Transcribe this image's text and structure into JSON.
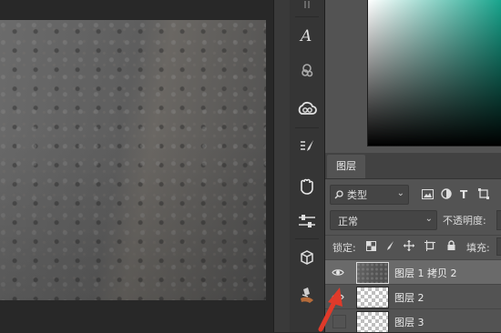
{
  "toolbar_icons": [
    "grip-icon",
    "character-icon",
    "paragraph-style-icon",
    "creative-cloud-icon",
    "brush-settings-icon",
    "glyph-hand-icon",
    "adjustments-icon",
    "3d-object-icon",
    "clone-source-icon"
  ],
  "colors": {
    "accent_teal": "#17a48c",
    "panel_bg": "#535353",
    "selected_row": "#6a6a6a",
    "arrow": "#e03a2a"
  },
  "layers_panel": {
    "tab_label": "图层",
    "filter": {
      "label": "类型",
      "icons": [
        "search-icon",
        "image-filter-icon",
        "adjustment-filter-icon",
        "text-filter-icon",
        "shape-filter-icon"
      ]
    },
    "blend_mode": "正常",
    "opacity_label": "不透明度:",
    "lock_label": "锁定:",
    "fill_label": "填充:",
    "layers": [
      {
        "name": "图层 1 拷贝 2",
        "visible": true,
        "selected": true
      },
      {
        "name": "图层 2",
        "visible": true,
        "selected": false
      },
      {
        "name": "图层 3",
        "visible": false,
        "selected": false
      }
    ]
  }
}
